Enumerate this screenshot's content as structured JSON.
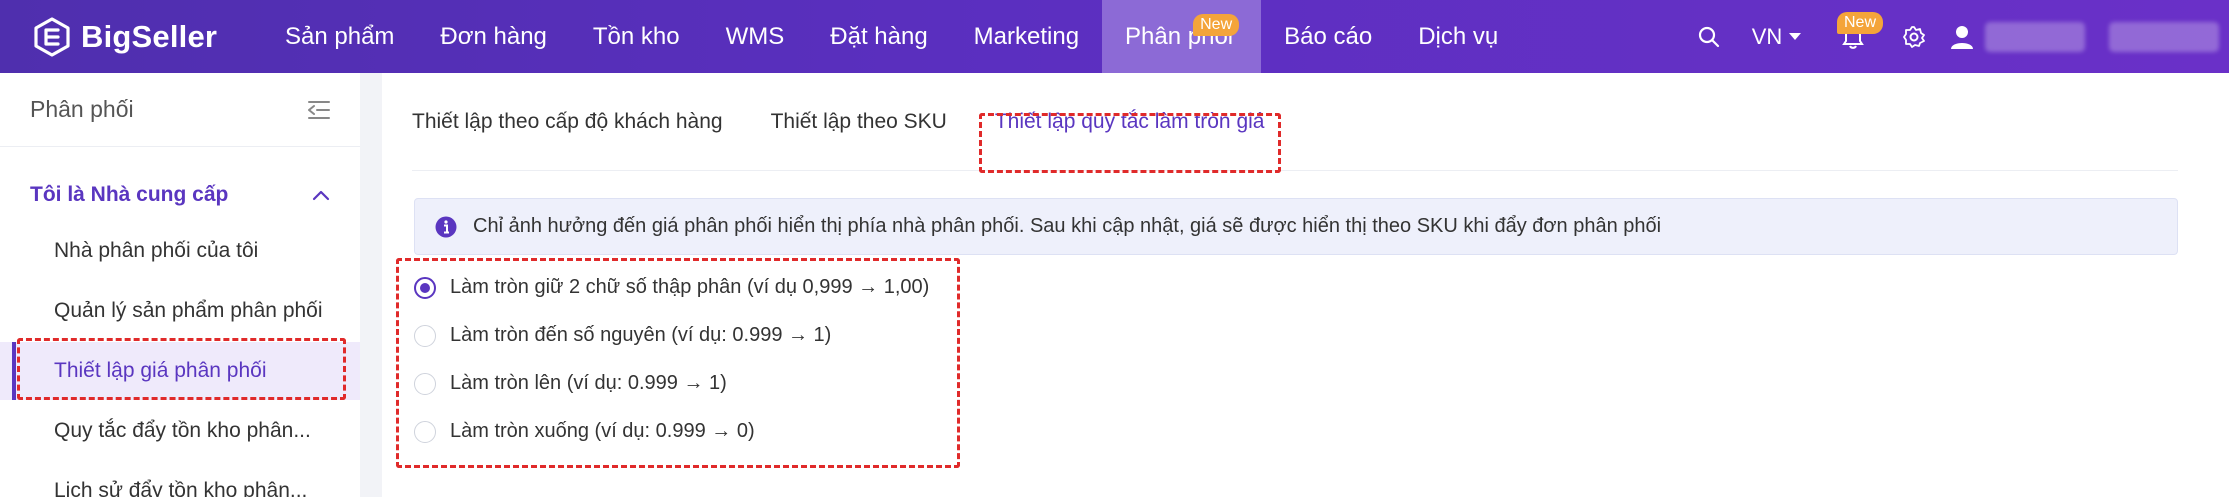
{
  "brand": {
    "name": "BigSeller"
  },
  "nav": {
    "items": [
      {
        "label": "Sản phẩm"
      },
      {
        "label": "Đơn hàng"
      },
      {
        "label": "Tồn kho"
      },
      {
        "label": "WMS"
      },
      {
        "label": "Đặt hàng"
      },
      {
        "label": "Marketing"
      },
      {
        "label": "Phân phối",
        "badge": "New"
      },
      {
        "label": "Báo cáo"
      },
      {
        "label": "Dịch vụ"
      }
    ],
    "language": "VN",
    "notification_badge": "New"
  },
  "sidebar": {
    "title": "Phân phối",
    "group_title": "Tôi là Nhà cung cấp",
    "items": [
      {
        "label": "Nhà phân phối của tôi"
      },
      {
        "label": "Quản lý sản phẩm phân phối"
      },
      {
        "label": "Thiết lập giá phân phối"
      },
      {
        "label": "Quy tắc đẩy tồn kho phân..."
      },
      {
        "label": "Lịch sử đẩy tồn kho phân..."
      }
    ]
  },
  "tabs": [
    {
      "label": "Thiết lập theo cấp độ khách hàng"
    },
    {
      "label": "Thiết lập theo SKU"
    },
    {
      "label": "Thiết lập quy tắc làm tròn giá"
    }
  ],
  "notice": "Chỉ ảnh hưởng đến giá phân phối hiển thị phía nhà phân phối. Sau khi cập nhật, giá sẽ được hiển thị theo SKU khi đẩy đơn phân phối",
  "rounding_options": [
    {
      "label": "Làm tròn giữ 2 chữ số thập phân (ví dụ 0,999 → 1,00)",
      "checked": true
    },
    {
      "label": "Làm tròn đến số nguyên (ví dụ: 0.999 → 1)",
      "checked": false
    },
    {
      "label": "Làm tròn lên (ví dụ: 0.999 → 1)",
      "checked": false
    },
    {
      "label": "Làm tròn xuống (ví dụ: 0.999 → 0)",
      "checked": false
    }
  ],
  "colors": {
    "primary": "#5a36c0",
    "topbar": "#5b2fc0",
    "badge": "#f4a43a",
    "annotation": "#e02a2a"
  }
}
